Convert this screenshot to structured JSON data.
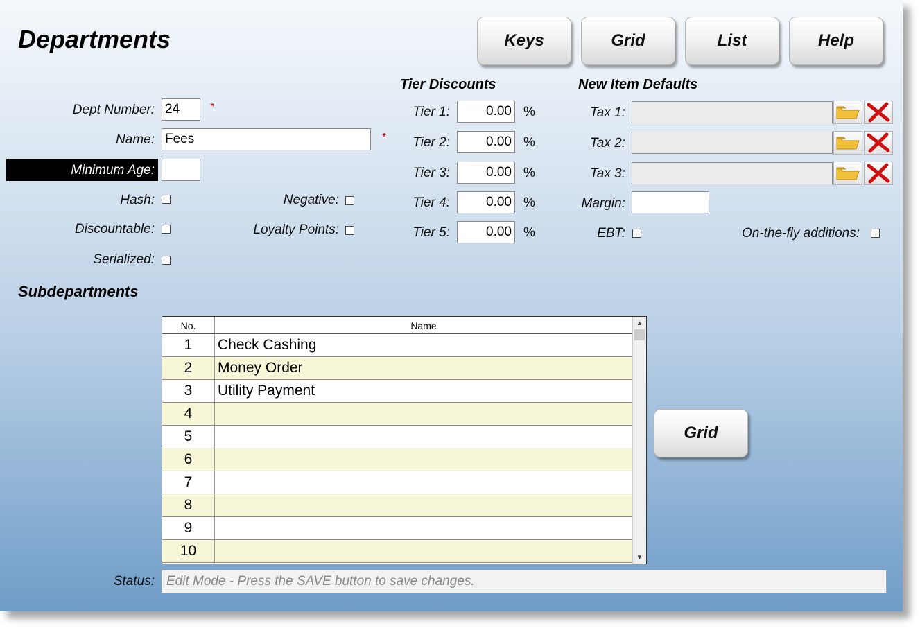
{
  "page": {
    "title": "Departments"
  },
  "toolbar": {
    "keys": "Keys",
    "grid": "Grid",
    "list": "List",
    "help": "Help"
  },
  "form": {
    "dept_number_label": "Dept Number:",
    "dept_number_value": "24",
    "name_label": "Name:",
    "name_value": "Fees",
    "required_mark": "*",
    "min_age_label": "Minimum Age:",
    "min_age_value": "",
    "hash_label": "Hash:",
    "negative_label": "Negative:",
    "discountable_label": "Discountable:",
    "loyalty_label": "Loyalty Points:",
    "serialized_label": "Serialized:"
  },
  "tiers": {
    "heading": "Tier Discounts",
    "percent": "%",
    "items": [
      {
        "label": "Tier 1:",
        "value": "0.00"
      },
      {
        "label": "Tier 2:",
        "value": "0.00"
      },
      {
        "label": "Tier 3:",
        "value": "0.00"
      },
      {
        "label": "Tier 4:",
        "value": "0.00"
      },
      {
        "label": "Tier 5:",
        "value": "0.00"
      }
    ]
  },
  "defaults": {
    "heading": "New Item Defaults",
    "tax1_label": "Tax 1:",
    "tax1_value": "",
    "tax2_label": "Tax 2:",
    "tax2_value": "",
    "tax3_label": "Tax 3:",
    "tax3_value": "",
    "margin_label": "Margin:",
    "margin_value": "",
    "ebt_label": "EBT:",
    "onthefly_label": "On-the-fly additions:"
  },
  "subdepartments": {
    "heading": "Subdepartments",
    "columns": {
      "no": "No.",
      "name": "Name"
    },
    "rows": [
      {
        "no": "1",
        "name": "Check Cashing"
      },
      {
        "no": "2",
        "name": "Money Order"
      },
      {
        "no": "3",
        "name": "Utility Payment"
      },
      {
        "no": "4",
        "name": ""
      },
      {
        "no": "5",
        "name": ""
      },
      {
        "no": "6",
        "name": ""
      },
      {
        "no": "7",
        "name": ""
      },
      {
        "no": "8",
        "name": ""
      },
      {
        "no": "9",
        "name": ""
      },
      {
        "no": "10",
        "name": ""
      }
    ],
    "grid_button": "Grid"
  },
  "status": {
    "label": "Status:",
    "text": "Edit Mode - Press the SAVE button to save changes."
  },
  "colors": {
    "alt_row": "#f7f7d8",
    "required": "#d01010",
    "delete_icon": "#d01010",
    "folder_icon": "#f2c13a"
  }
}
